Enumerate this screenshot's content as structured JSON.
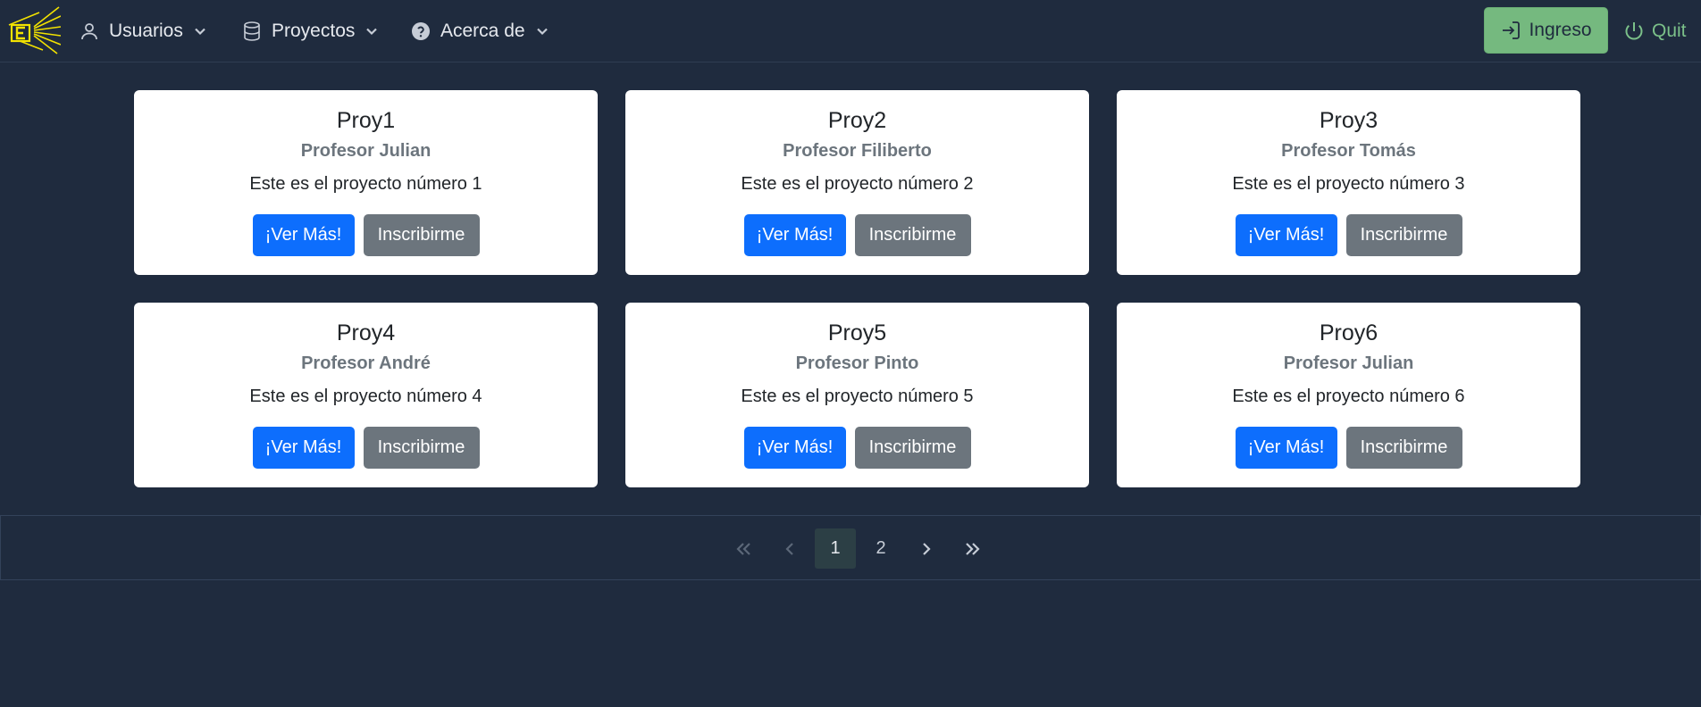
{
  "navbar": {
    "menus": [
      {
        "label": "Usuarios",
        "icon": "user-icon"
      },
      {
        "label": "Proyectos",
        "icon": "database-icon"
      },
      {
        "label": "Acerca de",
        "icon": "question-circle-icon"
      }
    ],
    "login_label": "Ingreso",
    "quit_label": "Quit"
  },
  "cards": [
    {
      "title": "Proy1",
      "subtitle": "Profesor Julian",
      "text": "Este es el proyecto número 1",
      "more_label": "¡Ver Más!",
      "enroll_label": "Inscribirme"
    },
    {
      "title": "Proy2",
      "subtitle": "Profesor Filiberto",
      "text": "Este es el proyecto número 2",
      "more_label": "¡Ver Más!",
      "enroll_label": "Inscribirme"
    },
    {
      "title": "Proy3",
      "subtitle": "Profesor Tomás",
      "text": "Este es el proyecto número 3",
      "more_label": "¡Ver Más!",
      "enroll_label": "Inscribirme"
    },
    {
      "title": "Proy4",
      "subtitle": "Profesor André",
      "text": "Este es el proyecto número 4",
      "more_label": "¡Ver Más!",
      "enroll_label": "Inscribirme"
    },
    {
      "title": "Proy5",
      "subtitle": "Profesor Pinto",
      "text": "Este es el proyecto número 5",
      "more_label": "¡Ver Más!",
      "enroll_label": "Inscribirme"
    },
    {
      "title": "Proy6",
      "subtitle": "Profesor Julian",
      "text": "Este es el proyecto número 6",
      "more_label": "¡Ver Más!",
      "enroll_label": "Inscribirme"
    }
  ],
  "pagination": {
    "pages": [
      "1",
      "2"
    ],
    "current": "1"
  },
  "colors": {
    "background": "#1f2b3e",
    "primary": "#0d6efd",
    "secondary": "#6c757d",
    "login_green": "#75b97f",
    "logo_yellow": "#f2e200"
  }
}
